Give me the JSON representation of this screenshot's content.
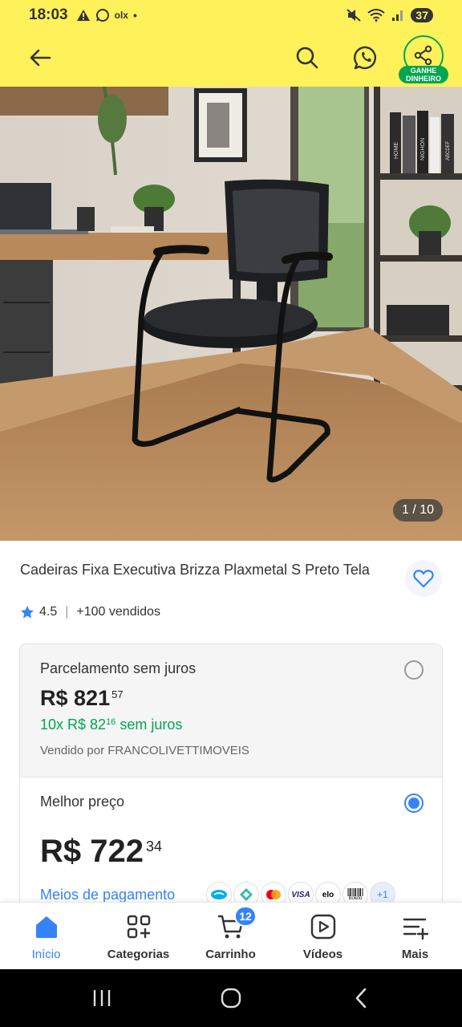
{
  "status_bar": {
    "time": "18:03",
    "left_icons": [
      "alert-icon",
      "whatsapp-icon",
      "olx-icon",
      "dot-icon"
    ],
    "olx_text": "olx",
    "right_icons": [
      "mute-icon",
      "wifi-icon",
      "signal-icon"
    ],
    "battery": "37"
  },
  "header": {
    "back_icon": "arrow-left-icon",
    "search_icon": "search-icon",
    "whatsapp_icon": "whatsapp-icon",
    "share_icon": "share-icon",
    "share_badge_line1": "GANHE",
    "share_badge_line2": "DINHEIRO",
    "accent_yellow": "#fff159",
    "accent_green": "#00a650"
  },
  "gallery": {
    "counter": "1 / 10",
    "book_spines": [
      "HOME",
      "NIGHON",
      "ABCDEF"
    ]
  },
  "product": {
    "title": "Cadeiras Fixa Executiva Brizza Plaxmetal S Preto Tela",
    "rating": "4.5",
    "sold": "+100 vendidos",
    "favorite_icon": "heart-icon"
  },
  "offers": [
    {
      "label": "Parcelamento sem juros",
      "price_currency": "R$",
      "price_int": "821",
      "price_cents": "57",
      "installments_prefix": "10x R$ 82",
      "installments_cents": "16",
      "installments_suffix": "sem juros",
      "seller": "Vendido por FRANCOLIVETTIMOVEIS",
      "selected": false
    },
    {
      "label": "Melhor preço",
      "price_currency": "R$",
      "price_int": "722",
      "price_cents": "34",
      "payment_link": "Meios de pagamento",
      "payment_methods": [
        "mercado-pago-icon",
        "pix-icon",
        "mastercard-icon",
        "visa-icon",
        "elo-icon",
        "boleto-icon"
      ],
      "payment_labels": [
        "VISA",
        "elo",
        "Boleto"
      ],
      "more_methods": "+1",
      "selected": true
    }
  ],
  "bottom_nav": {
    "items": [
      {
        "label": "Início",
        "icon": "home-icon",
        "active": true
      },
      {
        "label": "Categorias",
        "icon": "categories-icon",
        "active": false
      },
      {
        "label": "Carrinho",
        "icon": "cart-icon",
        "active": false,
        "badge": "12"
      },
      {
        "label": "Vídeos",
        "icon": "video-icon",
        "active": false
      },
      {
        "label": "Mais",
        "icon": "menu-plus-icon",
        "active": false
      }
    ],
    "accent_blue": "#3483fa"
  },
  "system_nav": {
    "icons": [
      "recent-apps-icon",
      "home-circle-icon",
      "back-chevron-icon"
    ]
  }
}
